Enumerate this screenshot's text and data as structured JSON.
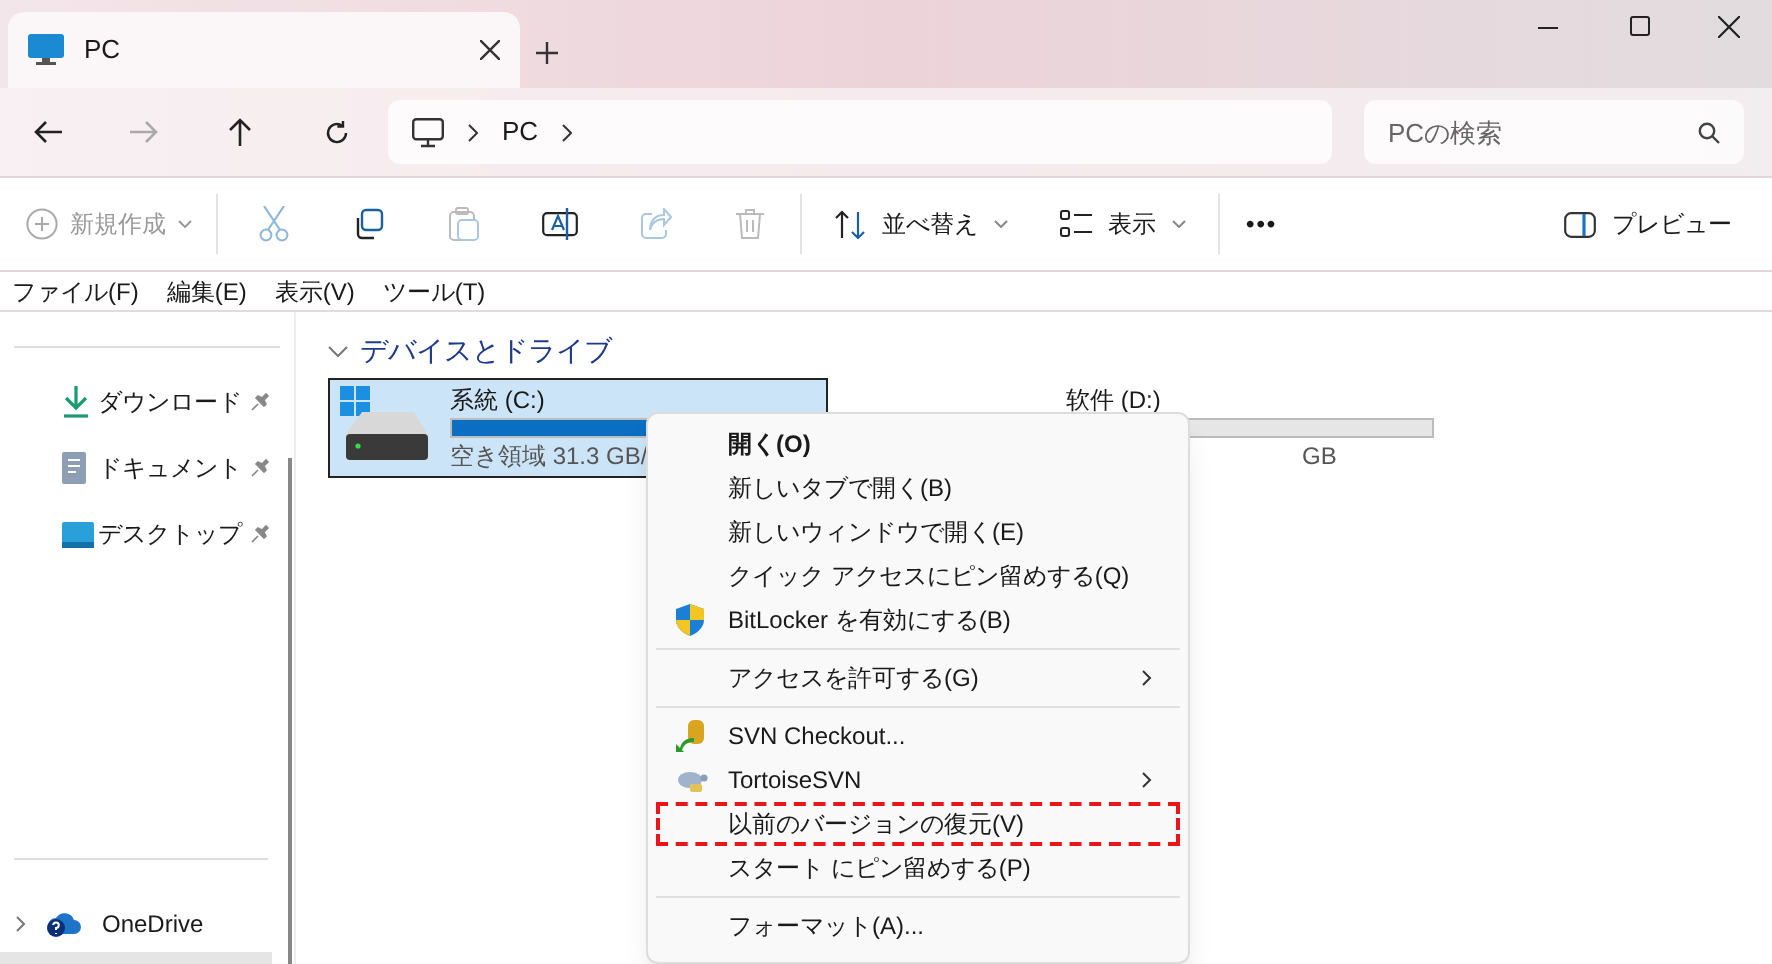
{
  "tab": {
    "title": "PC",
    "selected": true
  },
  "address": {
    "crumbs": [
      "PC"
    ]
  },
  "search": {
    "placeholder": "PCの検索"
  },
  "toolbar": {
    "new_label": "新規作成",
    "sort_label": "並べ替え",
    "view_label": "表示",
    "more": "•••",
    "preview_label": "プレビュー"
  },
  "menubar": [
    "ファイル(F)",
    "編集(E)",
    "表示(V)",
    "ツール(T)"
  ],
  "sidebar": {
    "items": [
      {
        "label": "ダウンロード",
        "kind": "download"
      },
      {
        "label": "ドキュメント",
        "kind": "document"
      },
      {
        "label": "デスクトップ",
        "kind": "desktop"
      }
    ],
    "tree": [
      {
        "label": "OneDrive",
        "expanded": false
      }
    ]
  },
  "section": {
    "title": "デバイスとドライブ",
    "expanded": true
  },
  "drives": [
    {
      "name": "系統 (C:)",
      "free": "空き領域 31.3 GB/",
      "level": 0.75,
      "selected": true,
      "kind": "system"
    },
    {
      "name": "软件 (D:)",
      "free": "GB",
      "selected": false
    }
  ],
  "context_menu": [
    {
      "label": "開く(O)",
      "bold": true,
      "kind": "plain",
      "submenu": false,
      "annotated": false
    },
    {
      "label": "新しいタブで開く(B)",
      "bold": false,
      "kind": "plain",
      "submenu": false,
      "annotated": false
    },
    {
      "label": "新しいウィンドウで開く(E)",
      "bold": false,
      "kind": "plain",
      "submenu": false,
      "annotated": false
    },
    {
      "label": "クイック アクセスにピン留めする(Q)",
      "bold": false,
      "kind": "plain",
      "submenu": false,
      "annotated": false
    },
    {
      "label": "BitLocker を有効にする(B)",
      "bold": false,
      "kind": "shield",
      "submenu": false,
      "annotated": false,
      "divider_after": true
    },
    {
      "label": "アクセスを許可する(G)",
      "bold": false,
      "kind": "plain",
      "submenu": true,
      "annotated": false,
      "divider_after": true
    },
    {
      "label": "SVN Checkout...",
      "bold": false,
      "kind": "svn",
      "submenu": false,
      "annotated": false
    },
    {
      "label": "TortoiseSVN",
      "bold": false,
      "kind": "tortoise",
      "submenu": true,
      "annotated": false
    },
    {
      "label": "以前のバージョンの復元(V)",
      "bold": false,
      "kind": "plain",
      "submenu": false,
      "annotated": true
    },
    {
      "label": "スタート にピン留めする(P)",
      "bold": false,
      "kind": "plain",
      "submenu": false,
      "annotated": false,
      "divider_after": true
    },
    {
      "label": "フォーマット(A)...",
      "bold": false,
      "kind": "plain",
      "submenu": false,
      "annotated": false
    }
  ]
}
